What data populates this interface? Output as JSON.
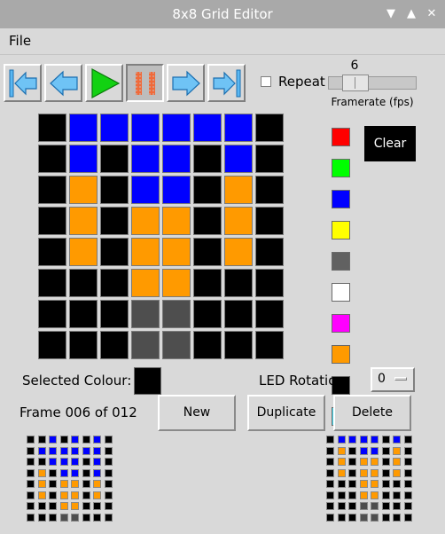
{
  "window": {
    "title": "8x8 Grid Editor"
  },
  "menu": {
    "file_label": "File"
  },
  "toolbar": {
    "repeat_label": "Repeat",
    "repeat_checked": false
  },
  "framerate": {
    "value": "6",
    "label": "Framerate (fps)",
    "min": 1,
    "max": 25
  },
  "palette": {
    "swatches": [
      "#ff0000",
      "#00ff00",
      "#0000ff",
      "#ffff00",
      "#616161",
      "#ffffff",
      "#ff00ff",
      "#ff9a00",
      "#000000",
      "#43daf0"
    ],
    "clear_label": "Clear"
  },
  "selection": {
    "label": "Selected Colour:",
    "color": "#000000"
  },
  "rotation": {
    "label": "LED Rotation:",
    "value": "0"
  },
  "frame": {
    "label": "Frame 006 of 012"
  },
  "buttons": {
    "new_label": "New",
    "duplicate_label": "Duplicate",
    "delete_label": "Delete"
  },
  "colors": {
    "K": "#000000",
    "B": "#0000ff",
    "O": "#ff9a00",
    "G": "#4e4e4e"
  },
  "grid": [
    [
      "K",
      "B",
      "B",
      "B",
      "B",
      "B",
      "B",
      "K"
    ],
    [
      "K",
      "B",
      "K",
      "B",
      "B",
      "K",
      "B",
      "K"
    ],
    [
      "K",
      "O",
      "K",
      "B",
      "B",
      "K",
      "O",
      "K"
    ],
    [
      "K",
      "O",
      "K",
      "O",
      "O",
      "K",
      "O",
      "K"
    ],
    [
      "K",
      "O",
      "K",
      "O",
      "O",
      "K",
      "O",
      "K"
    ],
    [
      "K",
      "K",
      "K",
      "O",
      "O",
      "K",
      "K",
      "K"
    ],
    [
      "K",
      "K",
      "K",
      "G",
      "G",
      "K",
      "K",
      "K"
    ],
    [
      "K",
      "K",
      "K",
      "G",
      "G",
      "K",
      "K",
      "K"
    ]
  ],
  "preview_prev": [
    [
      "K",
      "K",
      "B",
      "K",
      "B",
      "K",
      "B",
      "K"
    ],
    [
      "K",
      "B",
      "B",
      "B",
      "B",
      "B",
      "B",
      "K"
    ],
    [
      "K",
      "K",
      "B",
      "B",
      "B",
      "K",
      "B",
      "K"
    ],
    [
      "K",
      "O",
      "K",
      "B",
      "B",
      "K",
      "B",
      "K"
    ],
    [
      "K",
      "O",
      "K",
      "O",
      "O",
      "K",
      "O",
      "K"
    ],
    [
      "K",
      "O",
      "K",
      "O",
      "O",
      "K",
      "O",
      "K"
    ],
    [
      "K",
      "K",
      "K",
      "O",
      "O",
      "K",
      "K",
      "K"
    ],
    [
      "K",
      "K",
      "K",
      "G",
      "G",
      "K",
      "K",
      "K"
    ]
  ],
  "preview_next": [
    [
      "K",
      "B",
      "B",
      "B",
      "B",
      "K",
      "B",
      "K"
    ],
    [
      "K",
      "O",
      "K",
      "B",
      "B",
      "K",
      "O",
      "K"
    ],
    [
      "K",
      "O",
      "K",
      "O",
      "O",
      "K",
      "O",
      "K"
    ],
    [
      "K",
      "O",
      "K",
      "O",
      "O",
      "K",
      "O",
      "K"
    ],
    [
      "K",
      "K",
      "K",
      "O",
      "O",
      "K",
      "K",
      "K"
    ],
    [
      "K",
      "K",
      "K",
      "O",
      "O",
      "K",
      "K",
      "K"
    ],
    [
      "K",
      "K",
      "K",
      "G",
      "G",
      "K",
      "K",
      "K"
    ],
    [
      "K",
      "K",
      "K",
      "G",
      "G",
      "K",
      "K",
      "K"
    ]
  ]
}
